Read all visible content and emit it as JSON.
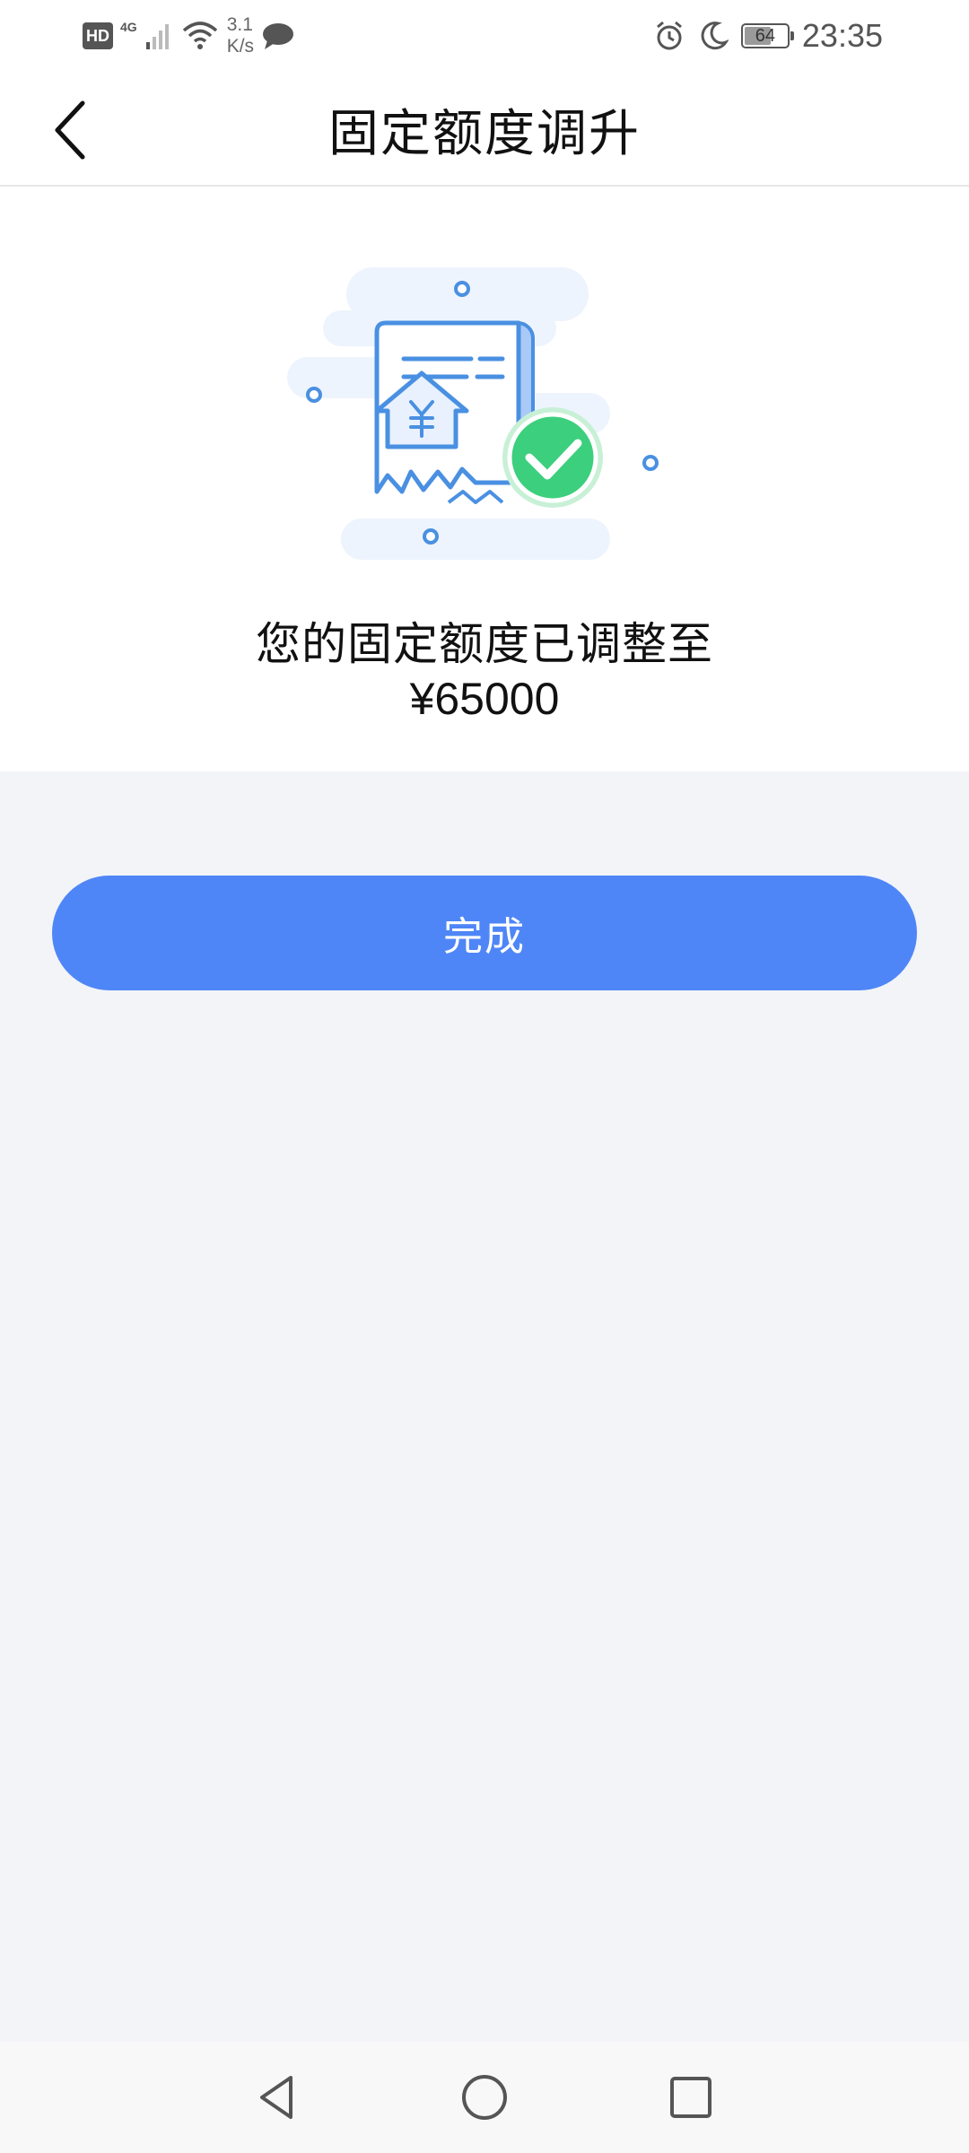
{
  "status_bar": {
    "hd_label": "HD",
    "network_type": "4G",
    "speed_value": "3.1",
    "speed_unit": "K/s",
    "battery_level": "64",
    "time": "23:35",
    "icons": [
      "signal-icon",
      "wifi-icon",
      "message-icon",
      "alarm-icon",
      "moon-icon",
      "battery-icon"
    ]
  },
  "header": {
    "title": "固定额度调升",
    "back_icon": "chevron-left-icon"
  },
  "result": {
    "illustration": "receipt-approved-illustration",
    "message": "您的固定额度已调整至",
    "amount": "¥65000"
  },
  "actions": {
    "done_label": "完成"
  },
  "colors": {
    "primary": "#4f86f7",
    "background": "#f2f4f8",
    "card": "#ffffff",
    "success": "#3ccf7d"
  },
  "nav_bar": {
    "icons": [
      "back-triangle-icon",
      "home-circle-icon",
      "recents-square-icon"
    ]
  }
}
